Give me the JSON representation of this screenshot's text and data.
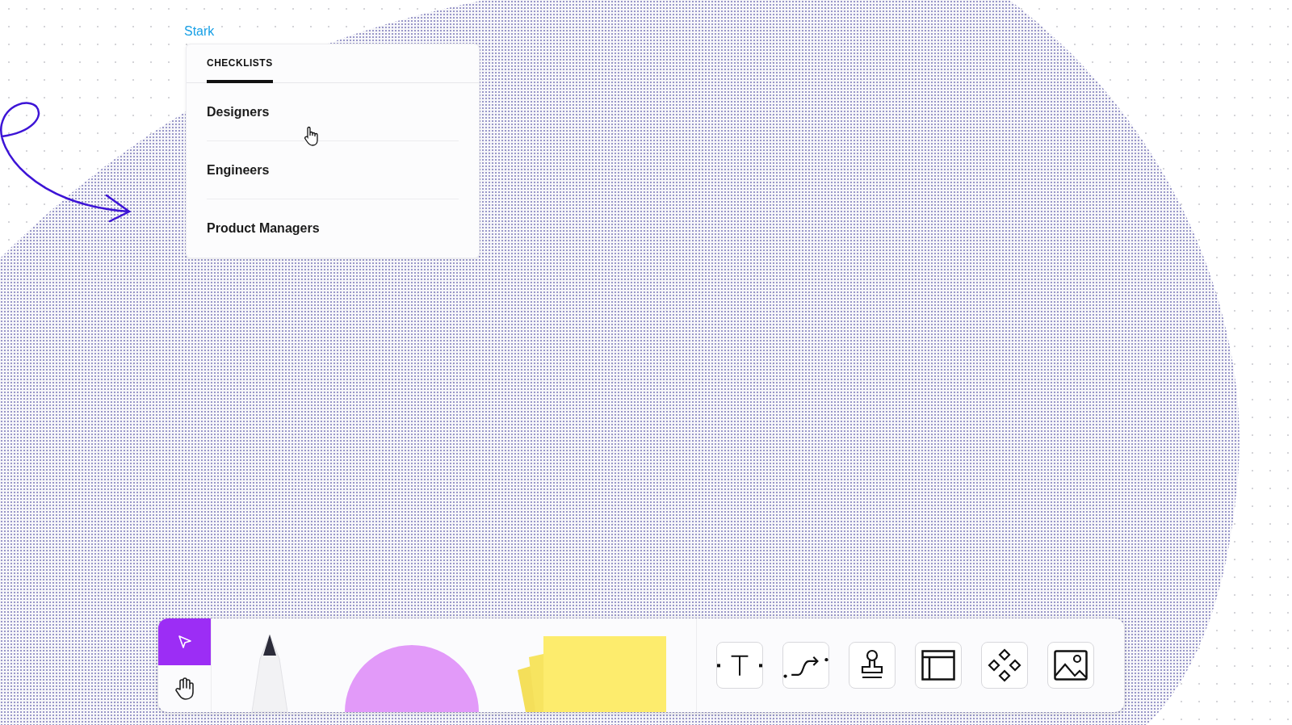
{
  "canvas": {
    "label": "Stark"
  },
  "panel": {
    "tabs": [
      {
        "label": "CHECKLISTS",
        "selected": true
      }
    ],
    "items": [
      {
        "label": "Designers"
      },
      {
        "label": "Engineers"
      },
      {
        "label": "Product Managers"
      }
    ]
  },
  "toolbar": {
    "modes": [
      {
        "kind": "select",
        "selected": true
      },
      {
        "kind": "hand",
        "selected": false
      }
    ],
    "tools": [
      {
        "kind": "text"
      },
      {
        "kind": "connector"
      },
      {
        "kind": "stamp"
      },
      {
        "kind": "section"
      },
      {
        "kind": "component"
      },
      {
        "kind": "image"
      }
    ]
  }
}
